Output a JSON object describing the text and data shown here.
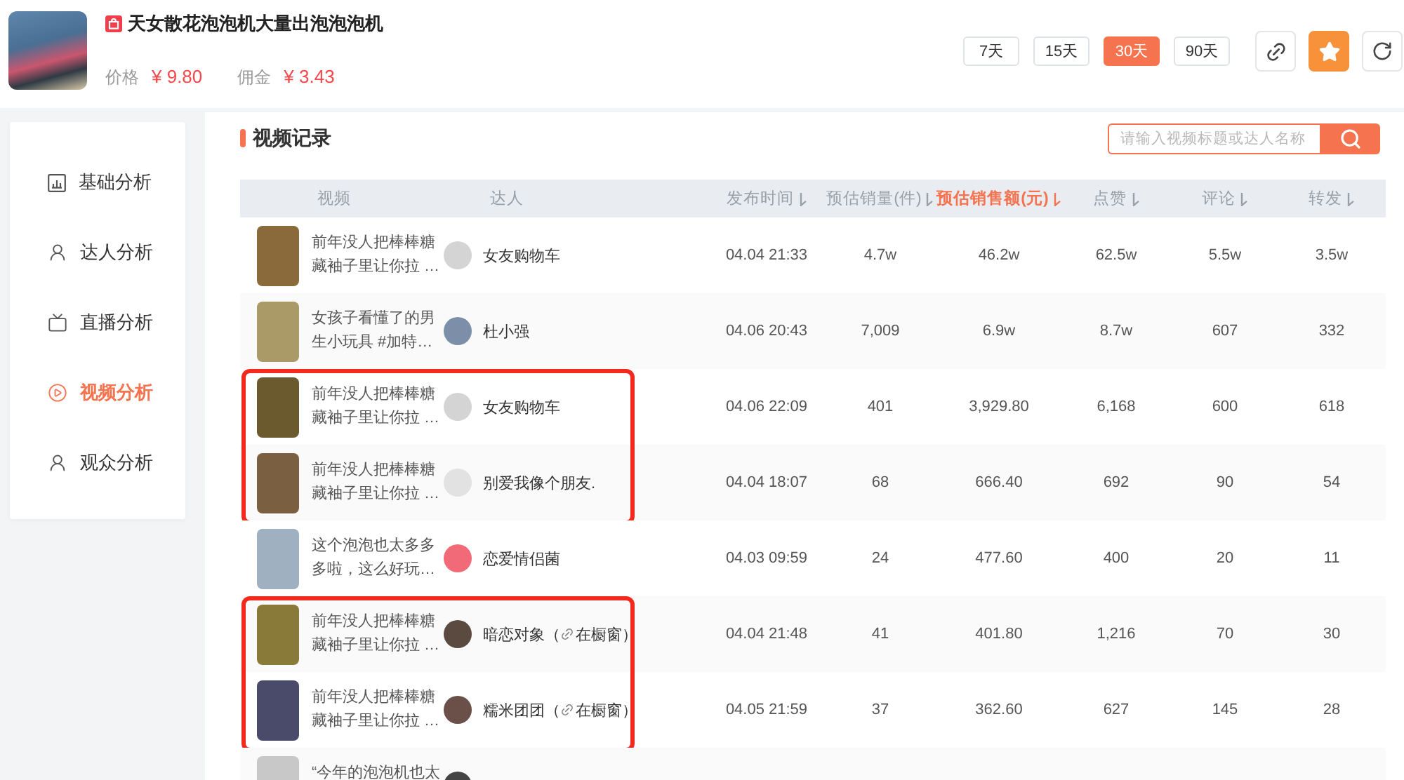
{
  "product": {
    "title": "天女散花泡泡机大量出泡泡泡机",
    "price_label": "价格",
    "price": "¥ 9.80",
    "commission_label": "佣金",
    "commission": "¥ 3.43"
  },
  "ranges": [
    {
      "label": "7天",
      "selected": false
    },
    {
      "label": "15天",
      "selected": false
    },
    {
      "label": "30天",
      "selected": true
    },
    {
      "label": "90天",
      "selected": false
    }
  ],
  "favorite": {
    "on": true
  },
  "sidebar": {
    "items": [
      {
        "label": "基础分析",
        "kind": "chart",
        "selected": false
      },
      {
        "label": "达人分析",
        "kind": "user",
        "selected": false
      },
      {
        "label": "直播分析",
        "kind": "live",
        "selected": false
      },
      {
        "label": "视频分析",
        "kind": "video",
        "selected": true
      },
      {
        "label": "观众分析",
        "kind": "user",
        "selected": false
      }
    ]
  },
  "section": {
    "title": "视频记录",
    "search": {
      "placeholder": "请输入视频标题或达人名称"
    }
  },
  "table": {
    "columns": [
      {
        "label": "视频",
        "sortable": false,
        "selected": false
      },
      {
        "label": "达人",
        "sortable": false,
        "selected": false
      },
      {
        "label": "发布时间",
        "sortable": true,
        "selected": false
      },
      {
        "label": "预估销量(件)",
        "sortable": true,
        "selected": false
      },
      {
        "label": "预估销售额(元)",
        "sortable": true,
        "selected": true
      },
      {
        "label": "点赞",
        "sortable": true,
        "selected": false
      },
      {
        "label": "评论",
        "sortable": true,
        "selected": false
      },
      {
        "label": "转发",
        "sortable": true,
        "selected": false
      }
    ],
    "row_groups": [
      {
        "highlighted": false,
        "rows": [
          {
            "title": "前年没人把棒棒糖藏袖子里让你拉 …",
            "creator": "女友购物车",
            "values": [
              "04.04 21:33",
              "4.7w",
              "46.2w",
              "62.5w",
              "5.5w",
              "3.5w"
            ]
          },
          {
            "title": "女孩子看懂了的男生小玩具 #加特…",
            "creator": "杜小强",
            "values": [
              "04.06 20:43",
              "7,009",
              "6.9w",
              "8.7w",
              "607",
              "332"
            ]
          }
        ]
      },
      {
        "highlighted": true,
        "rows": [
          {
            "title": "前年没人把棒棒糖藏袖子里让你拉 …",
            "creator": "女友购物车",
            "values": [
              "04.06 22:09",
              "401",
              "3,929.80",
              "6,168",
              "600",
              "618"
            ]
          },
          {
            "title": "前年没人把棒棒糖藏袖子里让你拉 …",
            "creator": "别爱我像个朋友.",
            "values": [
              "04.04 18:07",
              "68",
              "666.40",
              "692",
              "90",
              "54"
            ]
          }
        ]
      },
      {
        "highlighted": false,
        "rows": [
          {
            "title": "这个泡泡也太多多多啦，这么好玩…",
            "creator": "恋爱情侣菌",
            "values": [
              "04.03 09:59",
              "24",
              "477.60",
              "400",
              "20",
              "11"
            ]
          }
        ]
      },
      {
        "highlighted": true,
        "rows": [
          {
            "title": "前年没人把棒棒糖藏袖子里让你拉 …",
            "creator": "暗恋对象（",
            "tag": "在橱窗）",
            "values": [
              "04.04 21:48",
              "41",
              "401.80",
              "1,216",
              "70",
              "30"
            ]
          },
          {
            "title": "前年没人把棒棒糖藏袖子里让你拉 …",
            "creator": "糯米团团（",
            "tag": "在橱窗）",
            "values": [
              "04.05 21:59",
              "37",
              "362.60",
              "627",
              "145",
              "28"
            ]
          }
        ]
      },
      {
        "highlighted": false,
        "rows": [
          {
            "title": "“今年的泡泡机也太"
          }
        ]
      }
    ]
  }
}
